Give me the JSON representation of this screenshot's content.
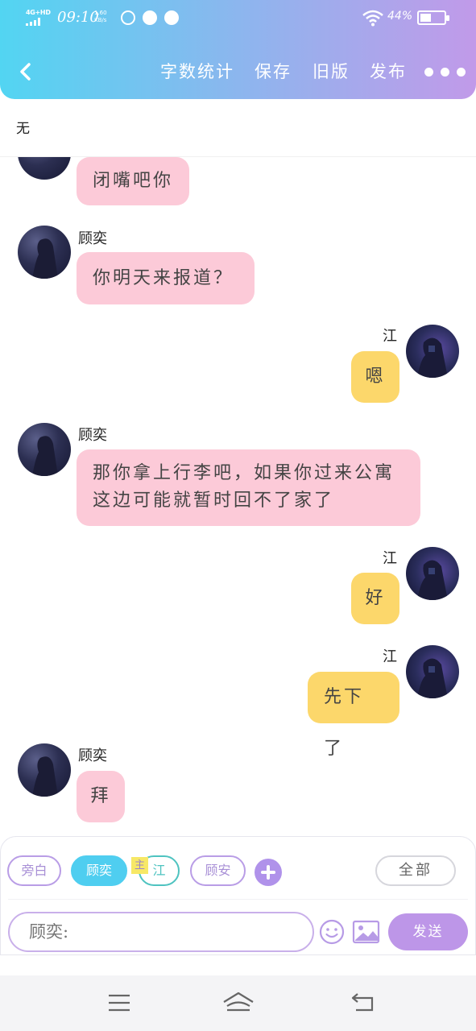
{
  "status_bar": {
    "network": "4G+HD",
    "time": "09:10",
    "speed_value": "1.60",
    "speed_unit": "KB/s",
    "battery": "44%"
  },
  "header": {
    "buttons": [
      "字数统计",
      "保存",
      "旧版",
      "发布"
    ],
    "more_icon": "more-dots-icon",
    "back_icon": "chevron-left-icon"
  },
  "subtitle": "无",
  "messages": [
    {
      "side": "left",
      "name": "",
      "text": "闭嘴吧你"
    },
    {
      "side": "left",
      "name": "顾奕",
      "text": "你明天来报道？"
    },
    {
      "side": "right",
      "name": "江",
      "text": "嗯"
    },
    {
      "side": "left",
      "name": "顾奕",
      "text": "那你拿上行李吧，如果你过来公寓这边可能就暂时回不了家了"
    },
    {
      "side": "right",
      "name": "江",
      "text": "好"
    },
    {
      "side": "right",
      "name": "江",
      "text": "先下了"
    },
    {
      "side": "left",
      "name": "顾奕",
      "text": "拜"
    }
  ],
  "toolbar": {
    "chips": [
      "旁白",
      "顾奕",
      "江",
      "顾安"
    ],
    "main_tag": "主",
    "all_label": "全部",
    "input_placeholder": "顾奕:",
    "send_label": "发送"
  },
  "colors": {
    "header_gradient_start": "#52d5f2",
    "header_gradient_end": "#c19ae9",
    "bubble_left": "#fccad8",
    "bubble_right": "#fcd76b",
    "accent_purple": "#bd96e8",
    "accent_cyan": "#4fcef0"
  }
}
